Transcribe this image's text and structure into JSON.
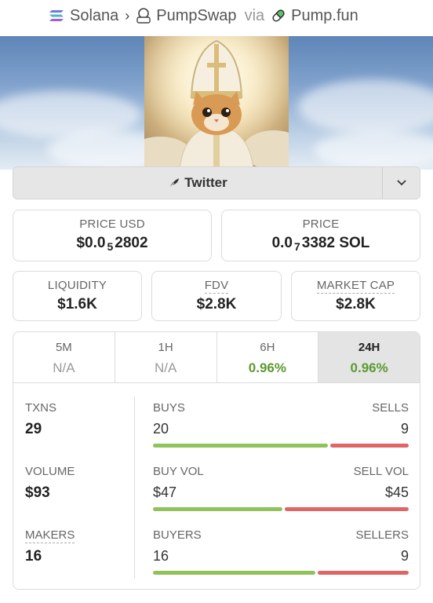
{
  "breadcrumb": {
    "chain": "Solana",
    "dex": "PumpSwap",
    "via": "via",
    "launchpad": "Pump.fun"
  },
  "social": {
    "twitter_label": "Twitter"
  },
  "price": {
    "usd_label": "PRICE USD",
    "usd_prefix": "$0.0",
    "usd_zeros": "5",
    "usd_digits": "2802",
    "native_label": "PRICE",
    "native_prefix": "0.0",
    "native_zeros": "7",
    "native_digits": "3382 SOL"
  },
  "metrics": [
    {
      "label": "LIQUIDITY",
      "value": "$1.6K"
    },
    {
      "label": "FDV",
      "value": "$2.8K"
    },
    {
      "label": "MARKET CAP",
      "value": "$2.8K"
    }
  ],
  "timeframes": [
    {
      "label": "5M",
      "value": "N/A"
    },
    {
      "label": "1H",
      "value": "N/A"
    },
    {
      "label": "6H",
      "value": "0.96%"
    },
    {
      "label": "24H",
      "value": "0.96%"
    }
  ],
  "stats": {
    "txns": {
      "label": "TXNS",
      "value": "29"
    },
    "volume": {
      "label": "VOLUME",
      "value": "$93"
    },
    "makers": {
      "label": "MAKERS",
      "value": "16"
    }
  },
  "bars": {
    "txns": {
      "left_label": "BUYS",
      "right_label": "SELLS",
      "left_value": "20",
      "right_value": "9",
      "left_share": 0.69
    },
    "volume": {
      "left_label": "BUY VOL",
      "right_label": "SELL VOL",
      "left_value": "$47",
      "right_value": "$45",
      "left_share": 0.51
    },
    "makers": {
      "left_label": "BUYERS",
      "right_label": "SELLERS",
      "left_value": "16",
      "right_value": "9",
      "left_share": 0.64
    }
  },
  "colors": {
    "buy": "#8fc35a",
    "sell": "#e06565",
    "positive": "#5d9932"
  }
}
